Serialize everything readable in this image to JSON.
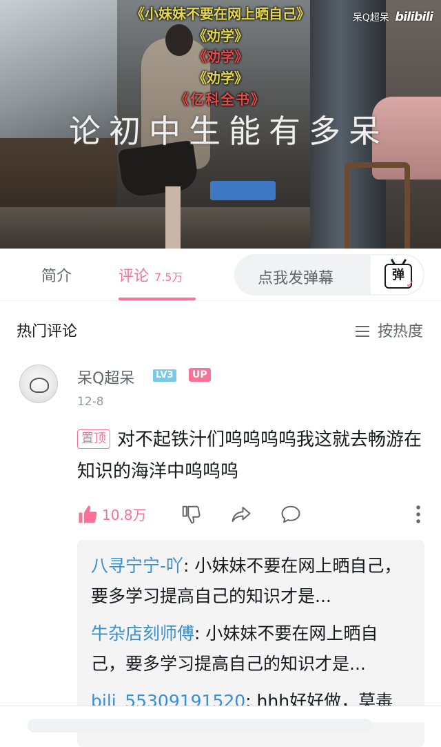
{
  "video": {
    "overlay_lines": [
      "《小妹妹不要在网上晒自己》",
      "《劝学》",
      "《劝学》",
      "《劝学》",
      "《亿科全书》"
    ],
    "big_caption": "论初中生能有多呆",
    "watermark_user": "呆Q超呆",
    "watermark_brand": "bilibili"
  },
  "tabs": {
    "intro_label": "简介",
    "comments_label": "评论",
    "comments_count": "7.5万",
    "danmaku_placeholder": "点我发弹幕",
    "danmaku_icon_text": "弹"
  },
  "section": {
    "title": "热门评论",
    "sort_label": "按热度"
  },
  "comment": {
    "username": "呆Q超呆",
    "level": "LV3",
    "up_badge": "UP",
    "date": "12-8",
    "pin_label": "置顶",
    "text": "对不起铁汁们呜呜呜呜我这就去畅游在知识的海洋中呜呜呜",
    "like_count": "10.8万",
    "accent_color": "#fb7299"
  },
  "replies": [
    {
      "name": "八寻宁宁-吖",
      "text": ": 小妹妹不要在网上晒自己，要多学习提高自己的知识才是..."
    },
    {
      "name": "牛杂店刻师傅",
      "text": ": 小妹妹不要在网上晒自己，要多学习提高自己的知识才是..."
    },
    {
      "name": "bili_55309191520",
      "text": ": hhh好好做，莫毒"
    }
  ]
}
